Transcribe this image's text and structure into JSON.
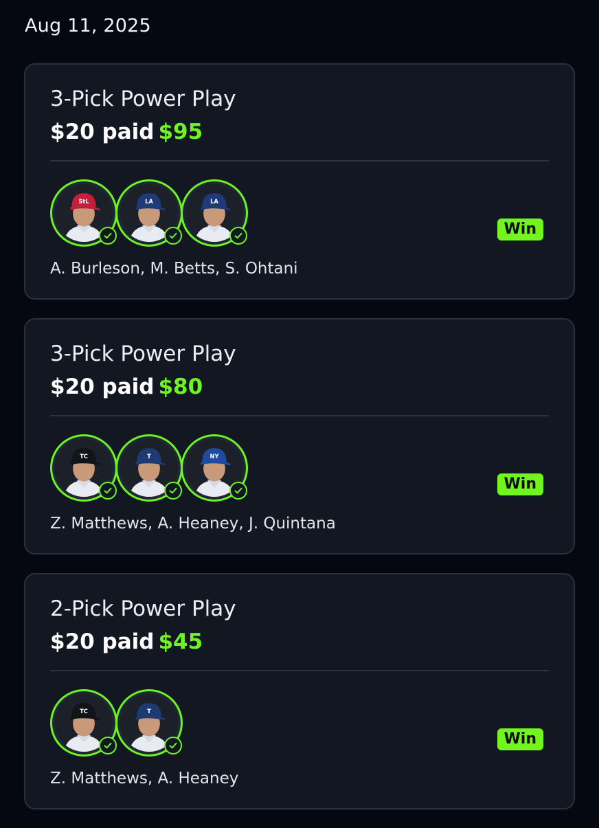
{
  "date": "Aug 11, 2025",
  "colors": {
    "background": "#050810",
    "card": "#131722",
    "accent_green": "#6cf522",
    "win_badge": "#72f41f"
  },
  "entries": [
    {
      "title": "3-Pick Power Play",
      "paid_label": "$20 paid",
      "payout": "$95",
      "result": "Win",
      "players_text": "A. Burleson, M. Betts, S. Ohtani",
      "avatars": [
        {
          "player": "A. Burleson",
          "team_cap": "cardinals-cap",
          "cap_color": "#c41e3a",
          "logo": "StL",
          "status": "check-icon"
        },
        {
          "player": "M. Betts",
          "team_cap": "dodgers-cap",
          "cap_color": "#1e3a7a",
          "logo": "LA",
          "status": "check-icon"
        },
        {
          "player": "S. Ohtani",
          "team_cap": "dodgers-cap",
          "cap_color": "#1e3a7a",
          "logo": "LA",
          "status": "check-icon"
        }
      ]
    },
    {
      "title": "3-Pick Power Play",
      "paid_label": "$20 paid",
      "payout": "$80",
      "result": "Win",
      "players_text": "Z. Matthews, A. Heaney, J. Quintana",
      "avatars": [
        {
          "player": "Z. Matthews",
          "team_cap": "twins-cap",
          "cap_color": "#111418",
          "logo": "TC",
          "status": "check-icon"
        },
        {
          "player": "A. Heaney",
          "team_cap": "rangers-cap",
          "cap_color": "#1d3a72",
          "logo": "T",
          "status": "check-icon"
        },
        {
          "player": "J. Quintana",
          "team_cap": "mets-cap",
          "cap_color": "#1f4aa0",
          "logo": "NY",
          "status": "check-icon"
        }
      ]
    },
    {
      "title": "2-Pick Power Play",
      "paid_label": "$20 paid",
      "payout": "$45",
      "result": "Win",
      "players_text": "Z. Matthews, A. Heaney",
      "avatars": [
        {
          "player": "Z. Matthews",
          "team_cap": "twins-cap",
          "cap_color": "#111418",
          "logo": "TC",
          "status": "check-icon"
        },
        {
          "player": "A. Heaney",
          "team_cap": "rangers-cap",
          "cap_color": "#1d3a72",
          "logo": "T",
          "status": "check-icon"
        }
      ]
    }
  ]
}
